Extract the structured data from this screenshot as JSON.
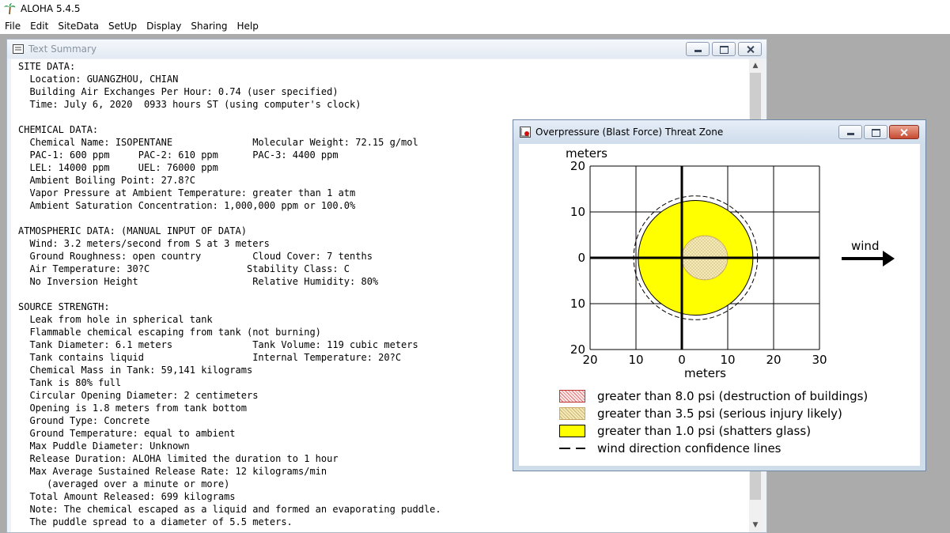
{
  "app": {
    "title": "ALOHA 5.4.5"
  },
  "menu": [
    "File",
    "Edit",
    "SiteData",
    "SetUp",
    "Display",
    "Sharing",
    "Help"
  ],
  "text_summary": {
    "title": "Text Summary",
    "lines": [
      "SITE DATA:",
      "  Location: GUANGZHOU, CHIAN",
      "  Building Air Exchanges Per Hour: 0.74 (user specified)",
      "  Time: July 6, 2020  0933 hours ST (using computer's clock)",
      "",
      "CHEMICAL DATA:",
      "  Chemical Name: ISOPENTANE              Molecular Weight: 72.15 g/mol",
      "  PAC-1: 600 ppm     PAC-2: 610 ppm      PAC-3: 4400 ppm",
      "  LEL: 14000 ppm     UEL: 76000 ppm",
      "  Ambient Boiling Point: 27.8?C",
      "  Vapor Pressure at Ambient Temperature: greater than 1 atm",
      "  Ambient Saturation Concentration: 1,000,000 ppm or 100.0%",
      "",
      "ATMOSPHERIC DATA: (MANUAL INPUT OF DATA)",
      "  Wind: 3.2 meters/second from S at 3 meters",
      "  Ground Roughness: open country         Cloud Cover: 7 tenths",
      "  Air Temperature: 30?C                 Stability Class: C",
      "  No Inversion Height                    Relative Humidity: 80%",
      "",
      "SOURCE STRENGTH:",
      "  Leak from hole in spherical tank",
      "  Flammable chemical escaping from tank (not burning)",
      "  Tank Diameter: 6.1 meters              Tank Volume: 119 cubic meters",
      "  Tank contains liquid                   Internal Temperature: 20?C",
      "  Chemical Mass in Tank: 59,141 kilograms",
      "  Tank is 80% full",
      "  Circular Opening Diameter: 2 centimeters",
      "  Opening is 1.8 meters from tank bottom",
      "  Ground Type: Concrete",
      "  Ground Temperature: equal to ambient",
      "  Max Puddle Diameter: Unknown",
      "  Release Duration: ALOHA limited the duration to 1 hour",
      "  Max Average Sustained Release Rate: 12 kilograms/min",
      "     (averaged over a minute or more)",
      "  Total Amount Released: 699 kilograms",
      "  Note: The chemical escaped as a liquid and formed an evaporating puddle.",
      "  The puddle spread to a diameter of 5.5 meters."
    ]
  },
  "threat_zone": {
    "title": "Overpressure (Blast Force) Threat Zone",
    "y_axis_label": "meters",
    "x_axis_label": "meters",
    "y_ticks": [
      "20",
      "10",
      "0",
      "10",
      "20"
    ],
    "x_ticks": [
      "20",
      "10",
      "0",
      "10",
      "20",
      "30"
    ],
    "wind_label": "wind",
    "zones": {
      "glass": {
        "center": [
          3,
          0
        ],
        "radius": 12.5,
        "color": "#ffff00"
      },
      "injury": {
        "center": [
          5,
          0
        ],
        "radius_x": 5,
        "radius_y": 4.8,
        "color": "#f4eab8"
      },
      "confidence": {
        "center": [
          3,
          0
        ],
        "radius": 13.5
      }
    },
    "legend": [
      {
        "text": "greater than 8.0 psi (destruction of buildings)",
        "swatch": "destruction"
      },
      {
        "text": "greater than 3.5 psi (serious injury likely)",
        "swatch": "injury"
      },
      {
        "text": "greater than 1.0 psi (shatters glass)",
        "swatch": "glass"
      },
      {
        "text": "wind direction confidence lines",
        "swatch": "confidence-lines"
      }
    ]
  }
}
